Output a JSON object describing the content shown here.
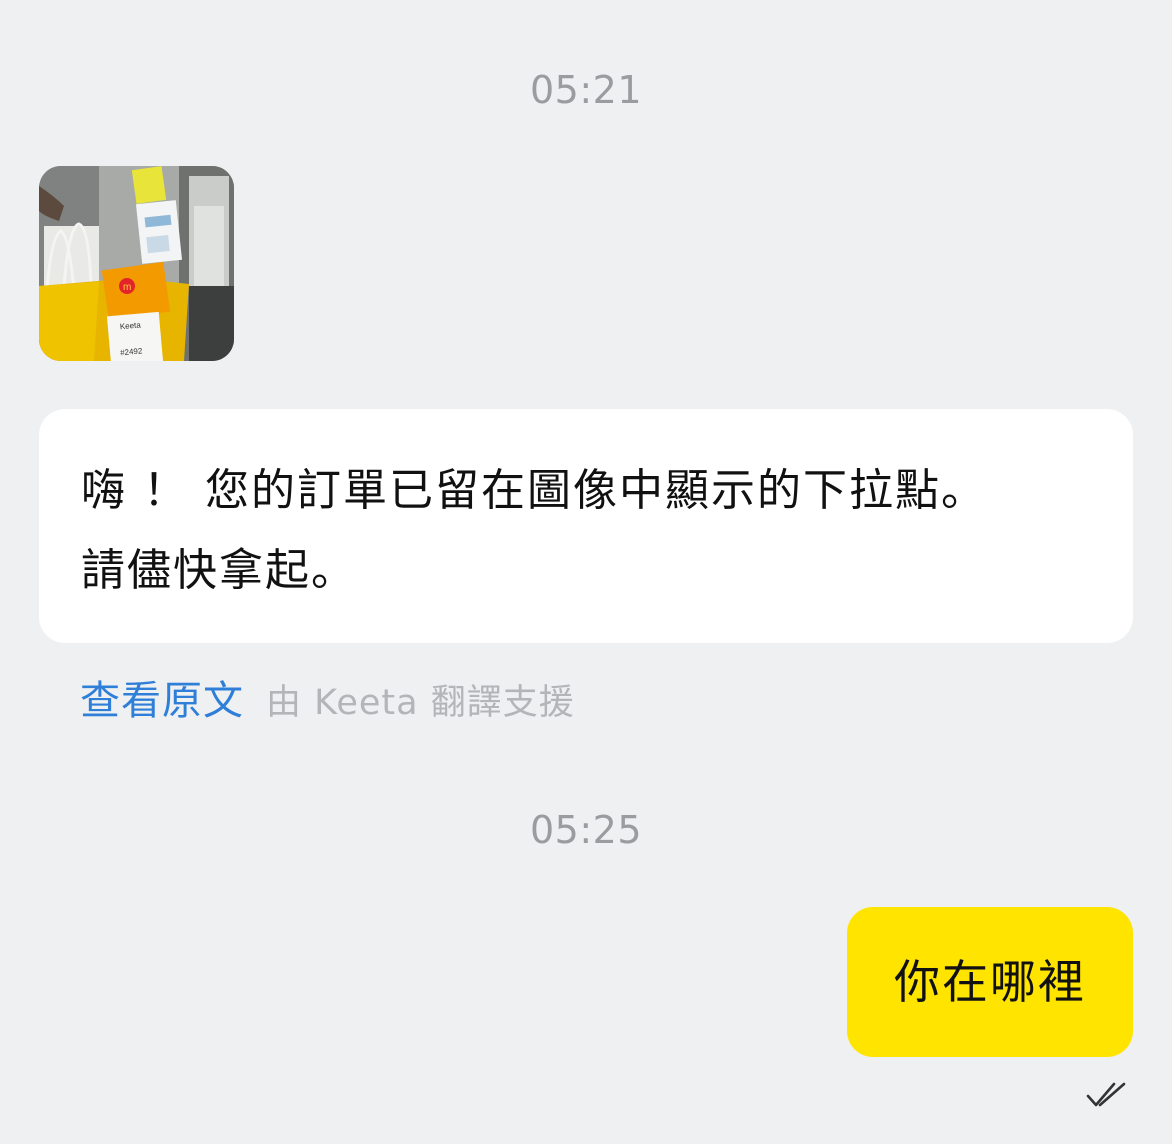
{
  "chat": {
    "timestamp_1": "05:21",
    "timestamp_2": "05:25",
    "incoming_photo": {
      "bag_label_brand": "Keeta",
      "bag_label_order": "#2492"
    },
    "incoming_message": {
      "line_1": "嗨 ！ 您的訂單已留在圖像中顯示的下拉點。",
      "line_2": "請儘快拿起。"
    },
    "translation": {
      "view_original": "查看原文",
      "provided_by": "由 Keeta 翻譯支援"
    },
    "outgoing_message": {
      "text": "你在哪裡",
      "status_icon": "double-check-icon"
    }
  },
  "colors": {
    "background": "#eef0f2",
    "incoming_bubble": "#ffffff",
    "outgoing_bubble": "#ffe400",
    "link": "#2f7fd8",
    "muted_text": "#9a9c9f"
  }
}
